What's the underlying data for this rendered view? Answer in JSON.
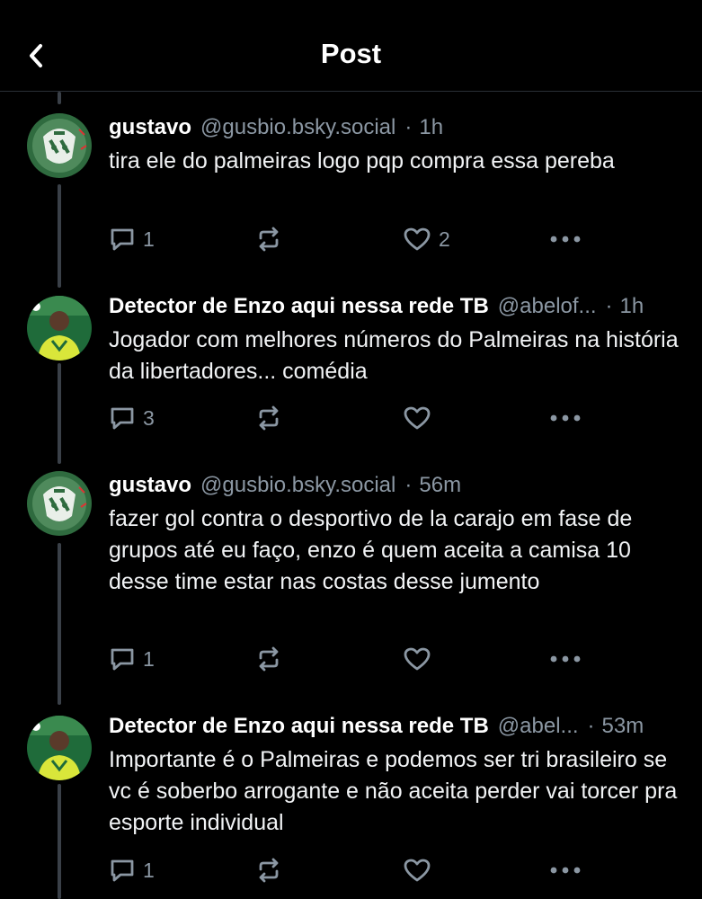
{
  "header": {
    "title": "Post"
  },
  "colors": {
    "background": "#000000",
    "muted": "#8b97a3",
    "divider": "#2a2f36",
    "thread_line": "#3a4048"
  },
  "posts": [
    {
      "name": "gustavo",
      "handle": "@gusbio.bsky.social",
      "sep": "·",
      "time": "1h",
      "text": "tira ele do palmeiras logo pqp compra essa pereba",
      "replies": "1",
      "reposts": "",
      "likes": "2",
      "avatar": "green-logo-avatar"
    },
    {
      "name": "Detector de Enzo aqui nessa rede TB",
      "handle": "@abelof...",
      "sep": "·",
      "time": "1h",
      "text": "Jogador com melhores números do Palmeiras na história da libertadores... comédia",
      "replies": "3",
      "reposts": "",
      "likes": "",
      "avatar": "player-photo-avatar"
    },
    {
      "name": "gustavo",
      "handle": "@gusbio.bsky.social",
      "sep": "·",
      "time": "56m",
      "text": "fazer gol contra o desportivo de la carajo em fase de grupos até eu faço, enzo é quem aceita a camisa 10 desse time estar nas costas desse jumento",
      "replies": "1",
      "reposts": "",
      "likes": "",
      "avatar": "green-logo-avatar"
    },
    {
      "name": "Detector de Enzo aqui nessa rede TB",
      "handle": "@abel...",
      "sep": "·",
      "time": "53m",
      "text": "Importante é o Palmeiras e podemos ser tri brasileiro se vc é soberbo arrogante e não aceita perder vai torcer pra esporte individual",
      "replies": "1",
      "reposts": "",
      "likes": "",
      "avatar": "player-photo-avatar"
    }
  ]
}
